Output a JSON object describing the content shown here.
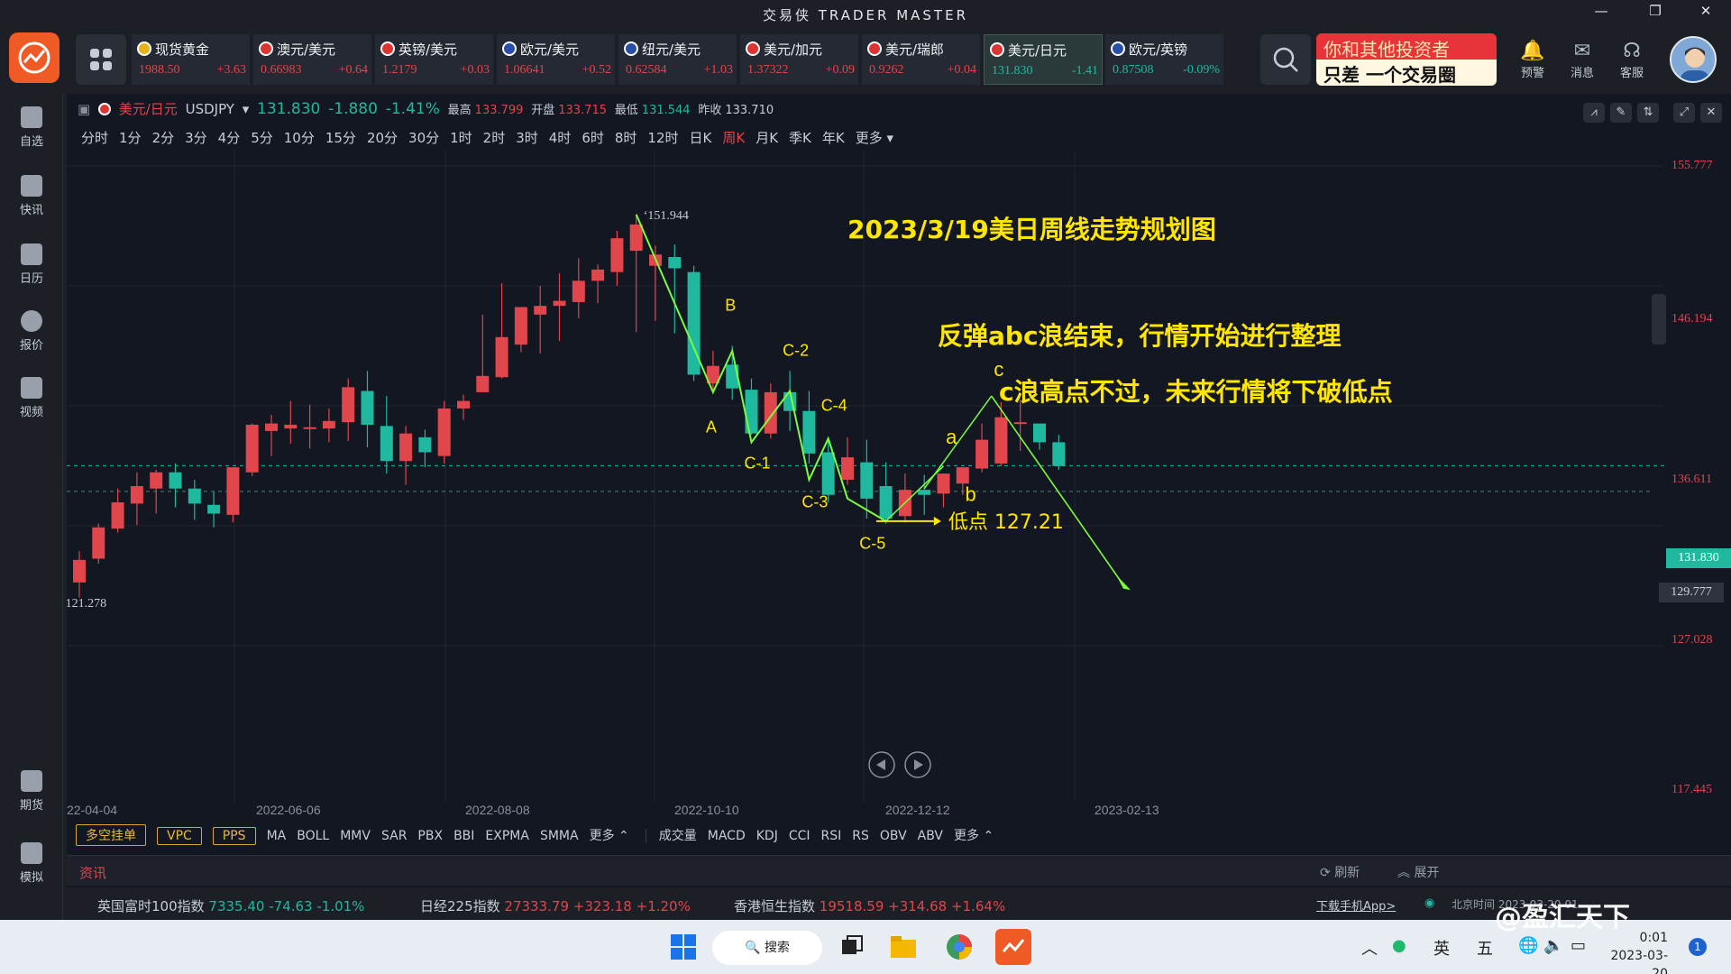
{
  "window": {
    "title": "交易侠 TRADER MASTER",
    "controls": [
      "—",
      "❐",
      "✕"
    ]
  },
  "tickers": [
    {
      "name": "现货黄金",
      "price": "1988.50",
      "change": "+3.63",
      "dir": "up"
    },
    {
      "name": "澳元/美元",
      "price": "0.66983",
      "change": "+0.64",
      "dir": "up"
    },
    {
      "name": "英镑/美元",
      "price": "1.2179",
      "change": "+0.03",
      "dir": "up"
    },
    {
      "name": "欧元/美元",
      "price": "1.06641",
      "change": "+0.52",
      "dir": "up"
    },
    {
      "name": "纽元/美元",
      "price": "0.62584",
      "change": "+1.03",
      "dir": "up"
    },
    {
      "name": "美元/加元",
      "price": "1.37322",
      "change": "+0.09",
      "dir": "up"
    },
    {
      "name": "美元/瑞郎",
      "price": "0.9262",
      "change": "+0.04",
      "dir": "up"
    },
    {
      "name": "美元/日元",
      "price": "131.830",
      "change": "-1.41",
      "dir": "down"
    },
    {
      "name": "欧元/英镑",
      "price": "0.87508",
      "change": "-0.09%",
      "dir": "down"
    }
  ],
  "promo": {
    "line1": "你和其他投资者",
    "line2": "只差 一个交易圈"
  },
  "topicons": [
    {
      "label": "预警",
      "icon": "bell-icon"
    },
    {
      "label": "消息",
      "icon": "mail-icon"
    },
    {
      "label": "客服",
      "icon": "headset-icon"
    }
  ],
  "sidebar": {
    "items": [
      {
        "label": "自选"
      },
      {
        "label": "快讯"
      },
      {
        "label": "日历"
      },
      {
        "label": "报价"
      },
      {
        "label": "视频"
      }
    ],
    "bottom": [
      {
        "label": "期货"
      },
      {
        "label": "模拟"
      }
    ]
  },
  "symbol": {
    "name": "美元/日元",
    "code": "USDJPY",
    "price": "131.830",
    "change": "-1.880",
    "change_pct": "-1.41%",
    "high_label": "最高",
    "high": "133.799",
    "open_label": "开盘",
    "open": "133.715",
    "low_label": "最低",
    "low": "131.544",
    "prev_label": "昨收",
    "prev": "133.710"
  },
  "timeframes": [
    "分时",
    "1分",
    "2分",
    "3分",
    "4分",
    "5分",
    "10分",
    "15分",
    "20分",
    "30分",
    "1时",
    "2时",
    "3时",
    "4时",
    "6时",
    "8时",
    "12时",
    "日K",
    "周K",
    "月K",
    "季K",
    "年K",
    "更多"
  ],
  "active_timeframe": "周K",
  "chart_data": {
    "type": "candlestick",
    "title": "2023/3/19美日周线走势规划图",
    "annotations": [
      "反弹abc浪结束，行情开始进行整理",
      "c浪高点不过，未来行情将下破低点"
    ],
    "y_ticks": [
      155.777,
      146.194,
      136.611,
      127.028,
      117.445
    ],
    "current_price": "131.830",
    "dashed_level": "129.777",
    "high_mark": "151.944",
    "low_mark": "121.278",
    "low_point_label": "低点 127.21",
    "x_labels": [
      "22-04-04",
      "2022-06-06",
      "2022-08-08",
      "2022-10-10",
      "2022-12-12",
      "2023-02-13"
    ],
    "wave_labels": [
      "A",
      "B",
      "C-1",
      "C-2",
      "C-3",
      "C-4",
      "C-5",
      "a",
      "b",
      "c"
    ],
    "candles": [
      [
        122.5,
        124.3,
        121.3,
        125.0
      ],
      [
        124.4,
        126.9,
        124.0,
        127.2
      ],
      [
        126.8,
        128.9,
        126.5,
        130.0
      ],
      [
        128.8,
        130.2,
        127.1,
        131.3
      ],
      [
        130.0,
        131.3,
        128.0,
        131.5
      ],
      [
        131.3,
        130.0,
        128.5,
        132.0
      ],
      [
        130.0,
        128.8,
        127.5,
        130.7
      ],
      [
        128.7,
        128.0,
        126.9,
        129.8
      ],
      [
        127.9,
        131.7,
        127.3,
        131.7
      ],
      [
        131.3,
        135.1,
        131.0,
        135.2
      ],
      [
        134.6,
        135.2,
        132.6,
        135.9
      ],
      [
        134.8,
        135.1,
        133.6,
        137.0
      ],
      [
        134.9,
        134.9,
        133.2,
        136.7
      ],
      [
        134.8,
        135.4,
        133.7,
        136.4
      ],
      [
        135.3,
        138.1,
        133.8,
        138.8
      ],
      [
        137.8,
        135.1,
        133.3,
        139.4
      ],
      [
        135.0,
        132.2,
        131.2,
        137.4
      ],
      [
        132.2,
        134.4,
        130.3,
        135.0
      ],
      [
        134.1,
        132.9,
        131.7,
        134.7
      ],
      [
        132.6,
        136.4,
        132.0,
        137.0
      ],
      [
        136.4,
        137.0,
        135.5,
        137.5
      ],
      [
        137.7,
        139.0,
        138.5,
        143.9
      ],
      [
        138.9,
        142.1,
        138.8,
        146.4
      ],
      [
        141.5,
        144.5,
        140.9,
        144.2
      ],
      [
        143.9,
        144.6,
        140.8,
        146.2
      ],
      [
        144.6,
        145.0,
        141.8,
        147.2
      ],
      [
        144.9,
        146.6,
        143.6,
        148.4
      ],
      [
        146.6,
        147.5,
        144.8,
        147.9
      ],
      [
        147.3,
        150.0,
        146.2,
        150.6
      ],
      [
        149.0,
        151.1,
        142.5,
        151.9
      ],
      [
        147.8,
        148.7,
        143.4,
        149.4
      ],
      [
        148.5,
        147.6,
        142.4,
        149.5
      ],
      [
        147.3,
        139.1,
        138.6,
        147.8
      ],
      [
        138.4,
        139.8,
        137.6,
        141.0
      ],
      [
        139.9,
        138.0,
        137.1,
        141.4
      ],
      [
        137.9,
        134.4,
        134.3,
        138.8
      ],
      [
        134.4,
        137.7,
        134.0,
        138.4
      ],
      [
        137.7,
        136.2,
        134.6,
        139.4
      ],
      [
        136.2,
        132.8,
        132.0,
        137.8
      ],
      [
        132.9,
        129.5,
        128.9,
        134.0
      ],
      [
        130.7,
        132.5,
        130.3,
        134.1
      ],
      [
        132.1,
        129.2,
        127.6,
        133.9
      ],
      [
        130.2,
        127.6,
        127.2,
        132.1
      ],
      [
        127.8,
        129.9,
        127.3,
        131.2
      ],
      [
        129.9,
        129.5,
        127.9,
        131.1
      ],
      [
        129.6,
        131.2,
        128.5,
        131.2
      ],
      [
        130.4,
        131.7,
        129.5,
        131.7
      ],
      [
        131.6,
        133.9,
        131.3,
        135.2
      ],
      [
        132.0,
        135.7,
        131.8,
        136.9
      ],
      [
        135.2,
        135.3,
        133.0,
        137.1
      ],
      [
        135.2,
        133.7,
        133.1,
        135.1
      ],
      [
        133.7,
        131.8,
        131.5,
        134.3
      ]
    ],
    "wave_path": [
      [
        "2022-10-24",
        151.9
      ],
      [
        "2022-11-21",
        137.7
      ],
      [
        "2022-11-28",
        141.0
      ],
      [
        "2022-12-05",
        133.7
      ],
      [
        "2022-12-12",
        137.8
      ],
      [
        "2022-12-19",
        130.7
      ],
      [
        "2022-12-26",
        134.0
      ],
      [
        "2023-01-02",
        129.2
      ],
      [
        "2023-01-16",
        127.4
      ]
    ]
  },
  "indicators_left": {
    "tags": [
      "多空挂单",
      "VPC",
      "PPS"
    ],
    "items": [
      "MA",
      "BOLL",
      "MMV",
      "SAR",
      "PBX",
      "BBI",
      "EXPMA",
      "SMMA",
      "更多"
    ]
  },
  "indicators_right": [
    "成交量",
    "MACD",
    "KDJ",
    "CCI",
    "RSI",
    "RS",
    "OBV",
    "ABV",
    "更多"
  ],
  "news": {
    "title": "资讯",
    "refresh": "刷新",
    "expand": "展开"
  },
  "indices": [
    {
      "name": "英国富时100指数",
      "value": "7335.40",
      "change": "-74.63",
      "pct": "-1.01%",
      "dir": "down"
    },
    {
      "name": "日经225指数",
      "value": "27333.79",
      "change": "+323.18",
      "pct": "+1.20%",
      "dir": "up"
    },
    {
      "name": "香港恒生指数",
      "value": "19518.59",
      "change": "+314.68",
      "pct": "+1.64%",
      "dir": "up"
    }
  ],
  "footer": {
    "download": "下载手机App>",
    "beijing_time": "北京时间 2023-03-20 01"
  },
  "taskbar": {
    "search": "搜索",
    "ime1": "英",
    "ime2": "五",
    "time": "0:01",
    "date": "2023-03-20",
    "badge": "1"
  },
  "watermark": "@盈汇天下",
  "colors": {
    "up": "#e0464b",
    "down": "#1fb9a0",
    "wave": "#7cfc3c",
    "annotation": "#ffe600"
  }
}
